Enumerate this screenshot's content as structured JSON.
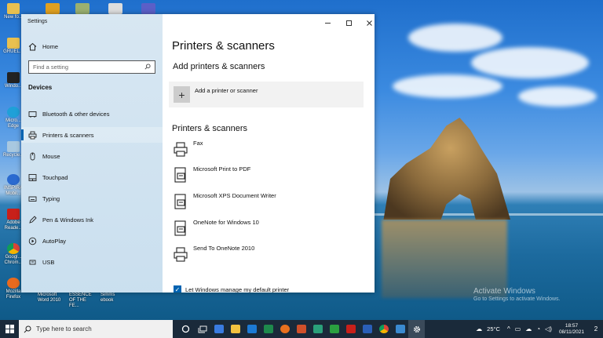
{
  "desktop": {
    "icons_left": [
      {
        "label": "New fo..."
      },
      {
        "label": "GRUEL..."
      },
      {
        "label": "Windo..."
      },
      {
        "label": "Micro... Edge"
      },
      {
        "label": "Recycle..."
      },
      {
        "label": "INSPIRA Mobil..."
      },
      {
        "label": "Adobe Reade..."
      },
      {
        "label": "Googl... Chrom..."
      },
      {
        "label": "Mozilla Firefox"
      }
    ],
    "icons_bottom": [
      {
        "label": "Microsoft Word 2010"
      },
      {
        "label": "ESSENCE OF THE FE..."
      },
      {
        "label": "Simms ebook"
      }
    ],
    "watermark": {
      "line1": "Activate Windows",
      "line2": "Go to Settings to activate Windows."
    }
  },
  "settings": {
    "window_title": "Settings",
    "home_label": "Home",
    "search_placeholder": "Find a setting",
    "section": "Devices",
    "nav": [
      {
        "label": "Bluetooth & other devices",
        "icon": "bluetooth-icon"
      },
      {
        "label": "Printers & scanners",
        "icon": "printer-icon"
      },
      {
        "label": "Mouse",
        "icon": "mouse-icon"
      },
      {
        "label": "Touchpad",
        "icon": "touchpad-icon"
      },
      {
        "label": "Typing",
        "icon": "keyboard-icon"
      },
      {
        "label": "Pen & Windows Ink",
        "icon": "pen-icon"
      },
      {
        "label": "AutoPlay",
        "icon": "autoplay-icon"
      },
      {
        "label": "USB",
        "icon": "usb-icon"
      }
    ],
    "active_nav": "Printers & scanners",
    "page_title": "Printers & scanners",
    "add_heading": "Add printers & scanners",
    "add_button": "Add a printer or scanner",
    "list_heading": "Printers & scanners",
    "printers": [
      {
        "name": "Fax",
        "icon": "fax-icon"
      },
      {
        "name": "Microsoft Print to PDF",
        "icon": "pdf-printer-icon"
      },
      {
        "name": "Microsoft XPS Document Writer",
        "icon": "xps-printer-icon"
      },
      {
        "name": "OneNote for Windows 10",
        "icon": "onenote-printer-icon"
      },
      {
        "name": "Send To OneNote 2010",
        "icon": "printer-icon"
      }
    ],
    "default_printer_checkbox": {
      "label": "Let Windows manage my default printer",
      "checked": true
    }
  },
  "taskbar": {
    "search_placeholder": "Type here to search",
    "temperature": "25°C",
    "time": "18:57",
    "date": "08/11/2021",
    "notification_count": "2",
    "accent": "#0063b1"
  }
}
